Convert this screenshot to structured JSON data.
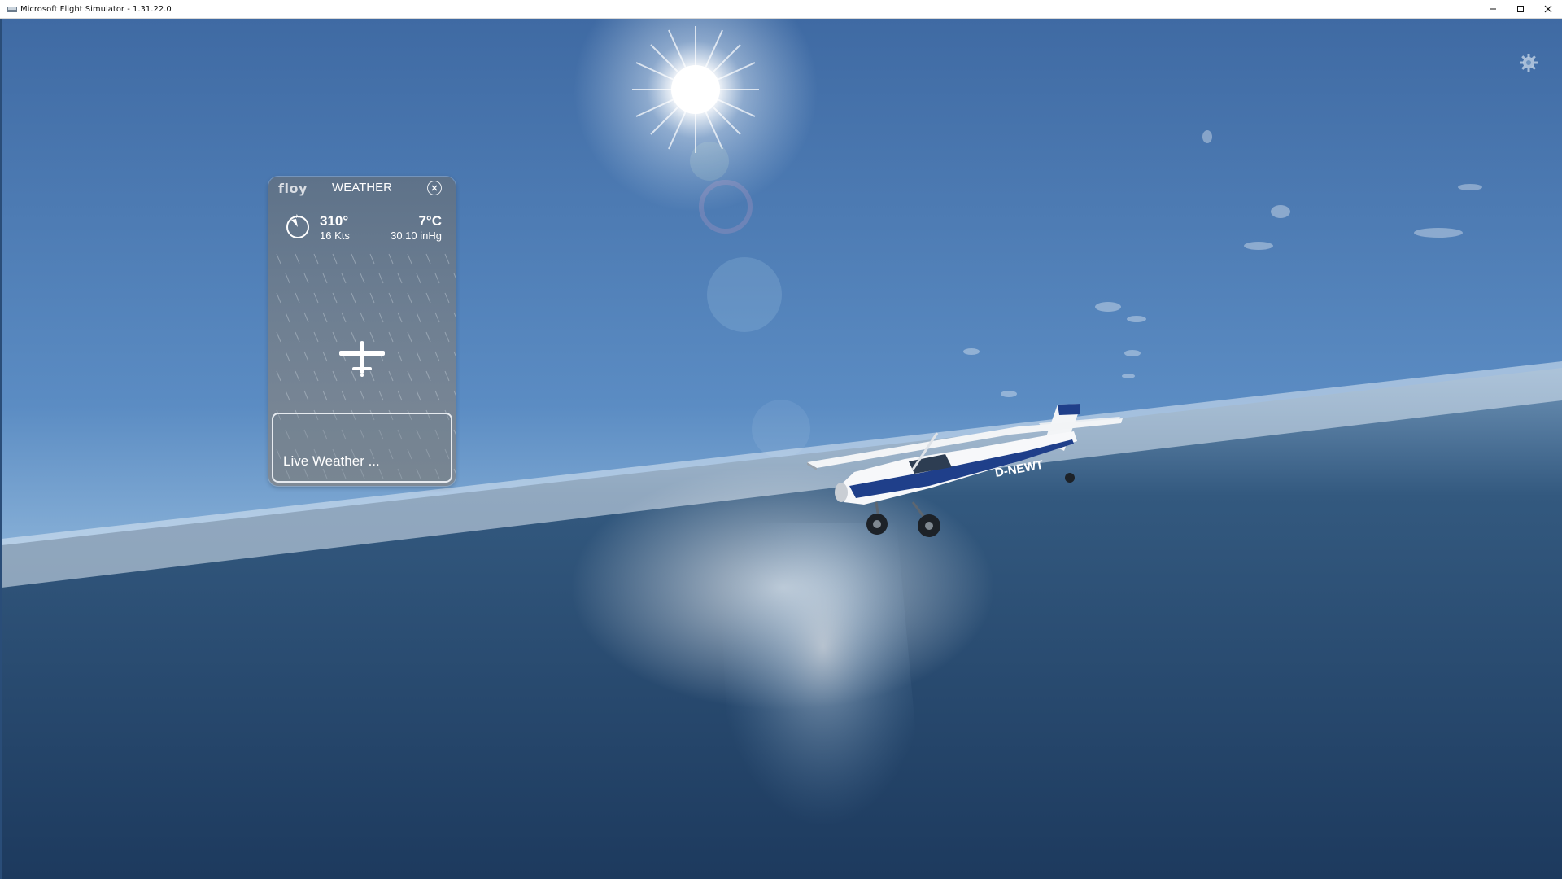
{
  "window": {
    "title": "Microsoft Flight Simulator - 1.31.22.0",
    "controls": [
      "minimize",
      "maximize",
      "close"
    ]
  },
  "scene": {
    "aircraft_registration": "D-NEWT"
  },
  "weather_panel": {
    "logo": "floy",
    "title": "WEATHER",
    "wind_direction": "310°",
    "wind_speed": "16 Kts",
    "temperature": "7°C",
    "pressure": "30.10 inHg",
    "live_weather_label": "Live Weather ..."
  },
  "icons": {
    "settings": "gear-icon",
    "close": "close-icon",
    "compass": "compass-icon",
    "aircraft": "airplane-icon"
  }
}
